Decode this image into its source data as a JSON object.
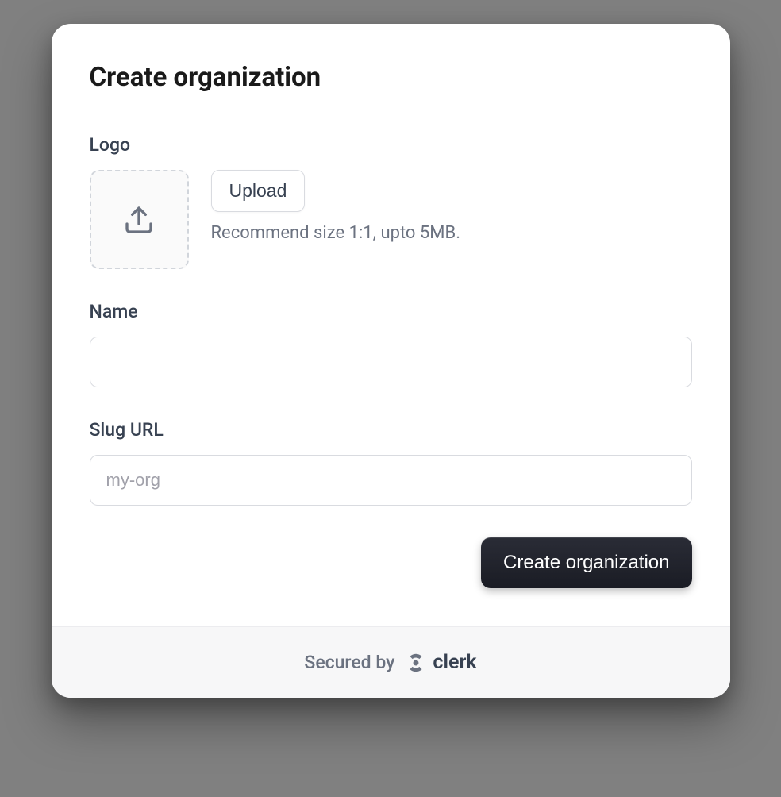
{
  "header": {
    "title": "Create organization"
  },
  "logo": {
    "label": "Logo",
    "upload_button": "Upload",
    "hint": "Recommend size 1:1, upto 5MB."
  },
  "name": {
    "label": "Name",
    "value": "",
    "placeholder": ""
  },
  "slug": {
    "label": "Slug URL",
    "value": "",
    "placeholder": "my-org"
  },
  "actions": {
    "submit": "Create organization"
  },
  "footer": {
    "secured_by": "Secured by",
    "brand": "clerk"
  }
}
